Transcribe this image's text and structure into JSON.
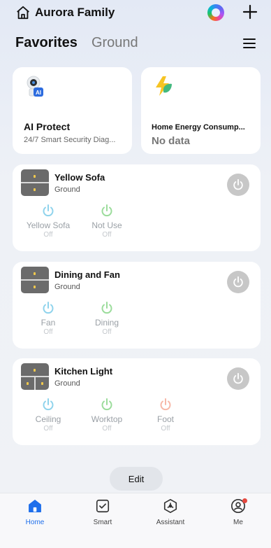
{
  "header": {
    "home_name": "Aurora Family"
  },
  "tabs": [
    {
      "label": "Favorites",
      "active": true
    },
    {
      "label": "Ground",
      "active": false
    }
  ],
  "feature_cards": [
    {
      "title": "AI Protect",
      "subtitle": "24/7 Smart Security Diag...",
      "icon": "ai-camera-icon"
    },
    {
      "title": "Home Energy Consump...",
      "value": "No data",
      "icon": "lightning-leaf-icon"
    }
  ],
  "devices": [
    {
      "name": "Yellow Sofa",
      "room": "Ground",
      "switches": [
        {
          "label": "Yellow Sofa",
          "state": "Off",
          "color": "#8fd3ec"
        },
        {
          "label": "Not Use",
          "state": "Off",
          "color": "#9bdc9b"
        }
      ]
    },
    {
      "name": "Dining and Fan",
      "room": "Ground",
      "switches": [
        {
          "label": "Fan",
          "state": "Off",
          "color": "#8fd3ec"
        },
        {
          "label": "Dining",
          "state": "Off",
          "color": "#9bdc9b"
        }
      ]
    },
    {
      "name": "Kitchen Light",
      "room": "Ground",
      "switches": [
        {
          "label": "Ceiling",
          "state": "Off",
          "color": "#8fd3ec"
        },
        {
          "label": "Worktop",
          "state": "Off",
          "color": "#9bdc9b"
        },
        {
          "label": "Foot",
          "state": "Off",
          "color": "#f7b8a8"
        }
      ]
    }
  ],
  "edit_label": "Edit",
  "nav": [
    {
      "label": "Home",
      "icon": "home-icon",
      "active": true
    },
    {
      "label": "Smart",
      "icon": "checkbox-icon",
      "active": false
    },
    {
      "label": "Assistant",
      "icon": "assistant-icon",
      "active": false
    },
    {
      "label": "Me",
      "icon": "profile-icon",
      "active": false
    }
  ],
  "colors": {
    "accent": "#1f6feb",
    "power_off": "#c7c7c7",
    "notification": "#e5483f"
  }
}
